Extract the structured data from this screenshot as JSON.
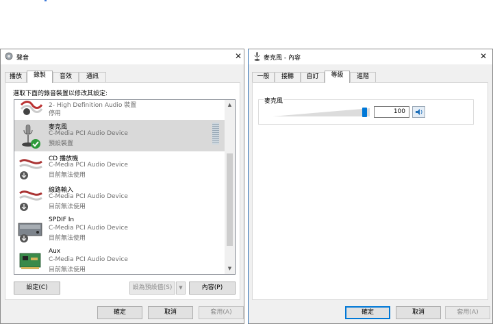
{
  "sound_window": {
    "title": "聲音",
    "tabs": [
      {
        "label": "播放"
      },
      {
        "label": "錄製"
      },
      {
        "label": "音效"
      },
      {
        "label": "通訊"
      }
    ],
    "instruction": "選取下面的錄音裝置以修改其設定:",
    "devices": [
      {
        "name": "",
        "device": "2- High Definition Audio 裝置",
        "status": "停用"
      },
      {
        "name": "麥克風",
        "device": "C-Media PCI Audio Device",
        "status": "預設裝置"
      },
      {
        "name": "CD 播放機",
        "device": "C-Media PCI Audio Device",
        "status": "目前無法使用"
      },
      {
        "name": "線路輸入",
        "device": "C-Media PCI Audio Device",
        "status": "目前無法使用"
      },
      {
        "name": "SPDIF In",
        "device": "C-Media PCI Audio Device",
        "status": "目前無法使用"
      },
      {
        "name": "Aux",
        "device": "C-Media PCI Audio Device",
        "status": "目前無法使用"
      }
    ],
    "buttons": {
      "configure": "設定(C)",
      "set_default": "設為預設值(S)",
      "properties": "內容(P)"
    },
    "dialog_buttons": {
      "ok": "確定",
      "cancel": "取消",
      "apply": "套用(A)"
    }
  },
  "mic_window": {
    "title": "麥克風 - 內容",
    "tabs": [
      {
        "label": "一般"
      },
      {
        "label": "接聽"
      },
      {
        "label": "自訂"
      },
      {
        "label": "等級"
      },
      {
        "label": "進階"
      }
    ],
    "level_label": "麥克風",
    "level_value": "100",
    "level_fraction": 1.0,
    "dialog_buttons": {
      "ok": "確定",
      "cancel": "取消",
      "apply": "套用(A)"
    }
  },
  "colors": {
    "accent": "#0078d7",
    "selection": "#d9d9d9",
    "check": "#2e9a3a"
  }
}
